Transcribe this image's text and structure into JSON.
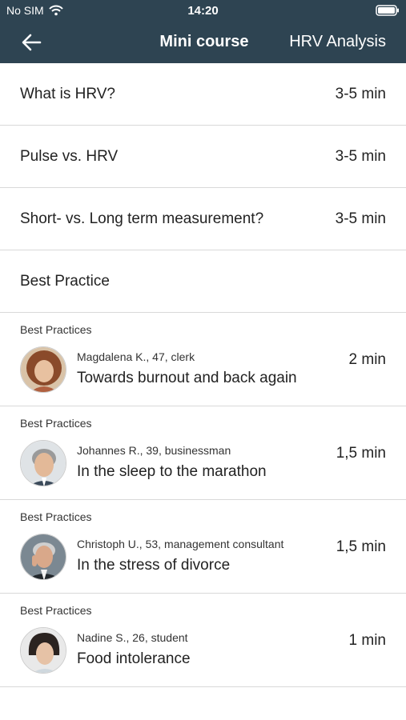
{
  "status_bar": {
    "carrier": "No SIM",
    "time": "14:20"
  },
  "nav": {
    "title": "Mini course",
    "right_label": "HRV Analysis"
  },
  "course_items": [
    {
      "title": "What is HRV?",
      "duration": "3-5 min"
    },
    {
      "title": "Pulse vs. HRV",
      "duration": "3-5 min"
    },
    {
      "title": "Short- vs. Long term measurement?",
      "duration": "3-5 min"
    },
    {
      "title": "Best Practice",
      "duration": ""
    }
  ],
  "stories": [
    {
      "category": "Best Practices",
      "person": "Magdalena K., 47, clerk",
      "title": "Towards burnout and back again",
      "duration": "2 min"
    },
    {
      "category": "Best Practices",
      "person": "Johannes R., 39, businessman",
      "title": "In the sleep to the marathon",
      "duration": "1,5 min"
    },
    {
      "category": "Best Practices",
      "person": "Christoph U., 53, management consultant",
      "title": "In the stress of divorce",
      "duration": "1,5 min"
    },
    {
      "category": "Best Practices",
      "person": "Nadine S., 26, student",
      "title": "Food intolerance",
      "duration": "1 min"
    }
  ]
}
